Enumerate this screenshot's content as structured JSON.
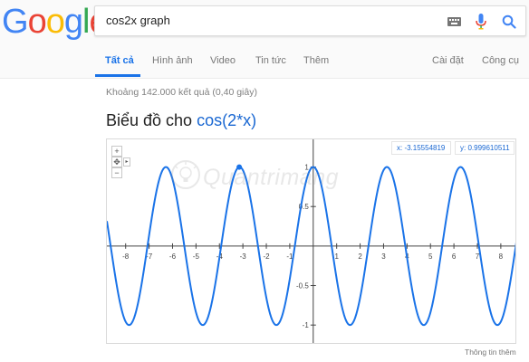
{
  "logo": {
    "letters": [
      {
        "ch": "G",
        "color": "#4285F4"
      },
      {
        "ch": "o",
        "color": "#EA4335"
      },
      {
        "ch": "o",
        "color": "#FBBC05"
      },
      {
        "ch": "g",
        "color": "#4285F4"
      },
      {
        "ch": "l",
        "color": "#34A853"
      },
      {
        "ch": "e",
        "color": "#EA4335"
      }
    ]
  },
  "search": {
    "query": "cos2x graph"
  },
  "nav": {
    "tabs": [
      "Tất cả",
      "Hình ảnh",
      "Video",
      "Tin tức",
      "Thêm"
    ],
    "settings": "Cài đặt",
    "tools": "Công cụ"
  },
  "result_stats": "Khoảng 142.000 kết quả (0,40 giây)",
  "graph": {
    "title_prefix": "Biểu đồ cho",
    "function": "cos(2*x)",
    "coord_x": "x: -3.15554819",
    "coord_y": "y: 0.999610511",
    "watermark": "Quantrimang",
    "more_info": "Thông tin thêm",
    "line_color": "#1a73e8"
  },
  "chart_data": {
    "type": "line",
    "function": "cos(2*x)",
    "xlim": [
      -8.8,
      8.7
    ],
    "ylim": [
      -1.25,
      1.35
    ],
    "x_ticks": [
      -8,
      -7,
      -6,
      -5,
      -4,
      -3,
      -2,
      -1,
      1,
      2,
      3,
      4,
      5,
      6,
      7,
      8
    ],
    "y_ticks": [
      -1,
      -0.5,
      0.5,
      1
    ],
    "y_tick_labels": [
      "-1",
      "-0.5",
      "0.5",
      "1"
    ],
    "highlight_point": {
      "x": -3.15554819,
      "y": 0.999610511
    },
    "grid": false
  }
}
